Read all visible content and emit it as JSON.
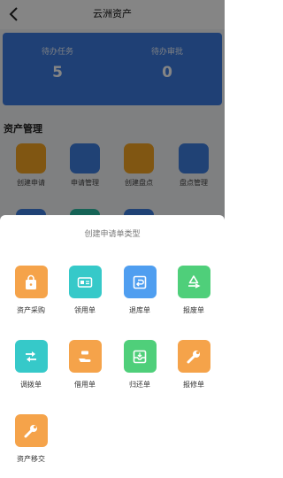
{
  "header": {
    "title": "云洲资产"
  },
  "stats": [
    {
      "label": "待办任务",
      "value": "5"
    },
    {
      "label": "待办审批",
      "value": "0"
    }
  ],
  "section": {
    "title": "资产管理"
  },
  "quick_items": [
    {
      "label": "创建申请",
      "color": "#f5a623"
    },
    {
      "label": "申请管理",
      "color": "#3f7fe0"
    },
    {
      "label": "创建盘点",
      "color": "#f5a623"
    },
    {
      "label": "盘点管理",
      "color": "#3f7fe0"
    }
  ],
  "sheet": {
    "title": "创建申请单类型",
    "items": [
      {
        "label": "资产采购",
        "color": "#f5a34a",
        "icon": "bag-icon"
      },
      {
        "label": "领用单",
        "color": "#36c9c9",
        "icon": "card-icon"
      },
      {
        "label": "退库单",
        "color": "#4f9ef0",
        "icon": "return-icon"
      },
      {
        "label": "报废单",
        "color": "#4fcf7a",
        "icon": "recycle-icon"
      },
      {
        "label": "调拨单",
        "color": "#36c9c9",
        "icon": "transfer-icon"
      },
      {
        "label": "借用单",
        "color": "#f5a34a",
        "icon": "hand-icon"
      },
      {
        "label": "归还单",
        "color": "#4fcf7a",
        "icon": "tray-icon"
      },
      {
        "label": "报修单",
        "color": "#f5a34a",
        "icon": "wrench-icon"
      },
      {
        "label": "资产移交",
        "color": "#f5a34a",
        "icon": "wrench-icon"
      }
    ]
  }
}
